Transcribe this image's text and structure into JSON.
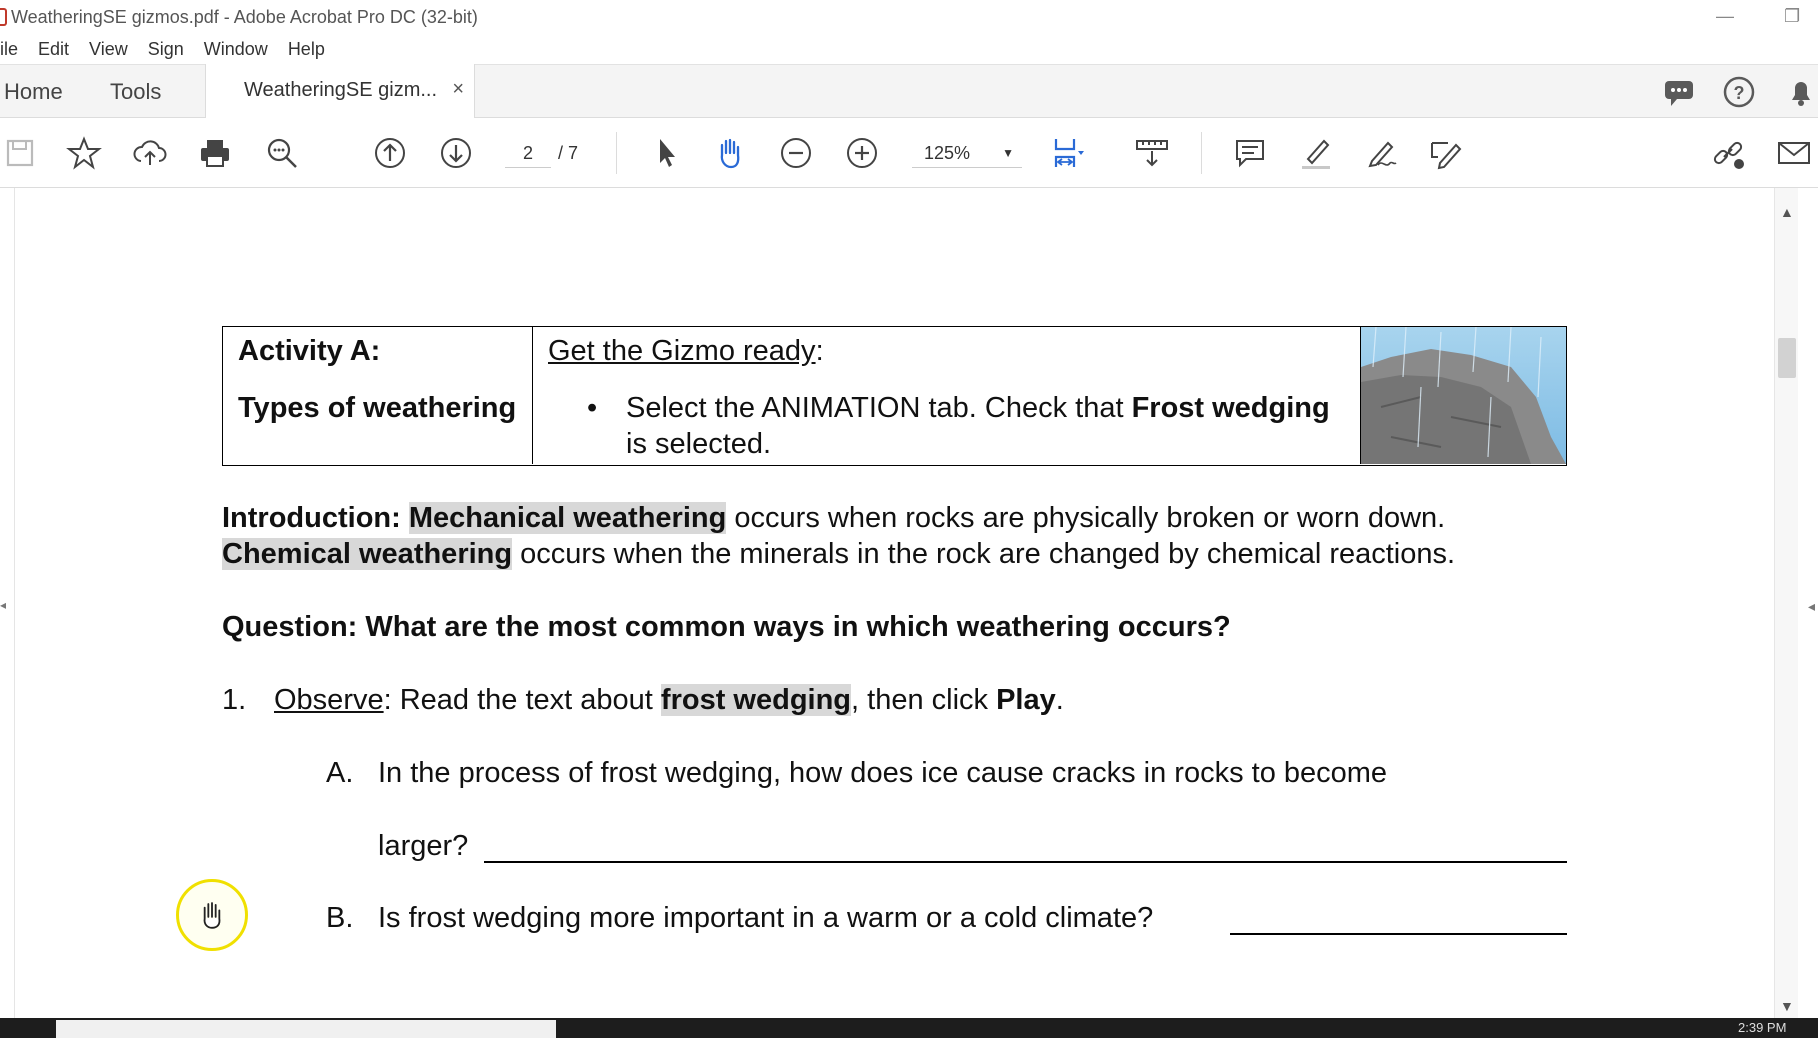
{
  "window": {
    "title": "WeatheringSE gizmos.pdf - Adobe Acrobat Pro DC (32-bit)",
    "minimize_icon": "minimize-icon",
    "restore_icon": "restore-icon"
  },
  "menu": [
    "ile",
    "Edit",
    "View",
    "Sign",
    "Window",
    "Help"
  ],
  "tabs": {
    "home": "Home",
    "tools": "Tools",
    "document": "WeatheringSE gizm...",
    "close": "×"
  },
  "toolbar": {
    "page_current": "2",
    "page_total": "/ 7",
    "zoom": "125%",
    "icons": [
      "save-icon",
      "bookmark-star-icon",
      "cloud-upload-icon",
      "print-icon",
      "find-icon",
      "page-up-icon",
      "page-down-icon",
      "select-arrow-icon",
      "hand-tool-icon",
      "zoom-out-icon",
      "zoom-in-icon",
      "fit-page-icon",
      "scroll-mode-icon",
      "comment-icon",
      "highlight-icon",
      "sign-icon",
      "edit-icon",
      "share-link-icon",
      "email-icon"
    ]
  },
  "document": {
    "activity_title": "Activity A:",
    "activity_sub": "Types of weathering",
    "gizmo_ready": "Get the Gizmo ready",
    "gizmo_colon": ":",
    "bullet": "•",
    "bullet_part1": "Select the ANIMATION tab. Check that ",
    "bullet_bold": "Frost wedging",
    "bullet_part2": " is selected.",
    "intro_label": "Introduction: ",
    "intro_term1": "Mechanical weathering",
    "intro_text1": " occurs when rocks are physically broken or worn down.",
    "intro_term2": "Chemical weathering",
    "intro_text2": " occurs when the minerals in the rock are changed by chemical reactions.",
    "question": "Question: What are the most common ways in which weathering occurs?",
    "q1_num": "1.",
    "q1_observe": "Observe",
    "q1_text1": ": Read the text about ",
    "q1_term": "frost wedging",
    "q1_text2": ", then click ",
    "q1_play": "Play",
    "q1_end": ".",
    "qa_letter": "A.",
    "qa_text": "In the process of frost wedging, how does ice cause cracks in rocks to become",
    "qa_text2": "larger?",
    "qb_letter": "B.",
    "qb_text": "Is frost wedging more important in a warm or a cold climate?"
  },
  "taskbar": {
    "clock": "2:39 PM"
  },
  "colors": {
    "accent_blue": "#2a6ad6",
    "highlight_gray": "#d8d8d8",
    "cursor_ring": "#f0e000"
  }
}
